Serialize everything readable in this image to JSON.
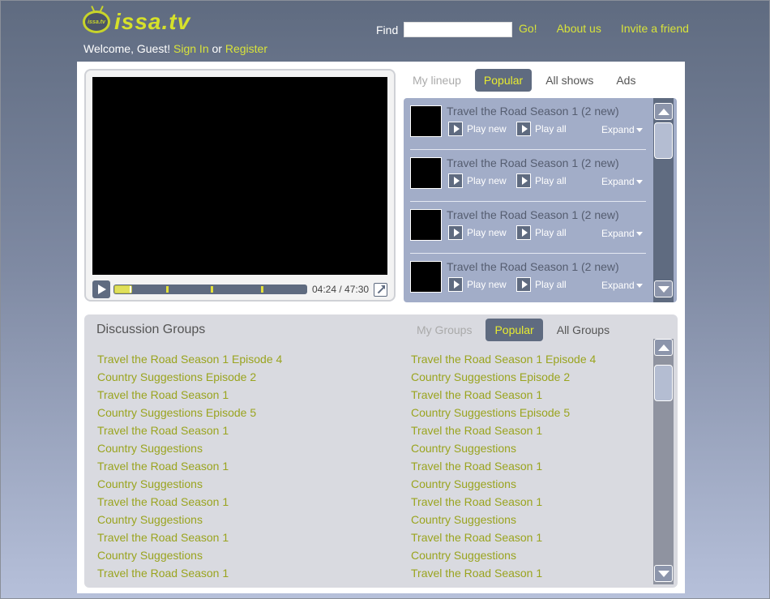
{
  "header": {
    "logo_badge": "issa.tv",
    "brand": "issa.tv",
    "welcome_text": "Welcome, Guest!",
    "sign_in": "Sign In",
    "or_text": "or",
    "register": "Register",
    "find_label": "Find",
    "find_value": "",
    "go": "Go!",
    "about": "About us",
    "invite": "Invite a friend"
  },
  "player": {
    "time": "04:24 / 47:30",
    "progress_fraction": 0.093,
    "chapter_marks": [
      0.27,
      0.5,
      0.76
    ]
  },
  "show_tabs": [
    "My lineup",
    "Popular",
    "All shows",
    "Ads"
  ],
  "shows": [
    {
      "title": "Travel the Road Season 1 (2 new)",
      "play_new": "Play new",
      "play_all": "Play all",
      "expand": "Expand"
    },
    {
      "title": "Travel the Road Season 1 (2 new)",
      "play_new": "Play new",
      "play_all": "Play all",
      "expand": "Expand"
    },
    {
      "title": "Travel the Road Season 1 (2 new)",
      "play_new": "Play new",
      "play_all": "Play all",
      "expand": "Expand"
    },
    {
      "title": "Travel the Road Season 1 (2 new)",
      "play_new": "Play new",
      "play_all": "Play all",
      "expand": "Expand"
    }
  ],
  "groups": {
    "title": "Discussion Groups",
    "tabs": [
      "My Groups",
      "Popular",
      "All Groups"
    ],
    "left": [
      "Travel the Road Season 1 Episode 4",
      "Country Suggestions Episode 2",
      "Travel the Road Season 1",
      "Country Suggestions Episode 5",
      "Travel the Road Season 1",
      "Country Suggestions",
      "Travel the Road Season 1",
      "Country Suggestions",
      "Travel the Road Season 1",
      "Country Suggestions",
      "Travel the Road Season 1",
      "Country Suggestions",
      "Travel the Road Season 1"
    ],
    "right": [
      "Travel the Road Season 1 Episode 4",
      "Country Suggestions Episode 2",
      "Travel the Road Season 1",
      "Country Suggestions Episode 5",
      "Travel the Road Season 1",
      "Country Suggestions",
      "Travel the Road Season 1",
      "Country Suggestions",
      "Travel the Road Season 1",
      "Country Suggestions",
      "Travel the Road Season 1",
      "Country Suggestions",
      "Travel the Road Season 1"
    ]
  },
  "colors": {
    "accent": "#e8ec2f",
    "link": "#9aa41f",
    "tab_active_bg": "#5f6b80"
  }
}
